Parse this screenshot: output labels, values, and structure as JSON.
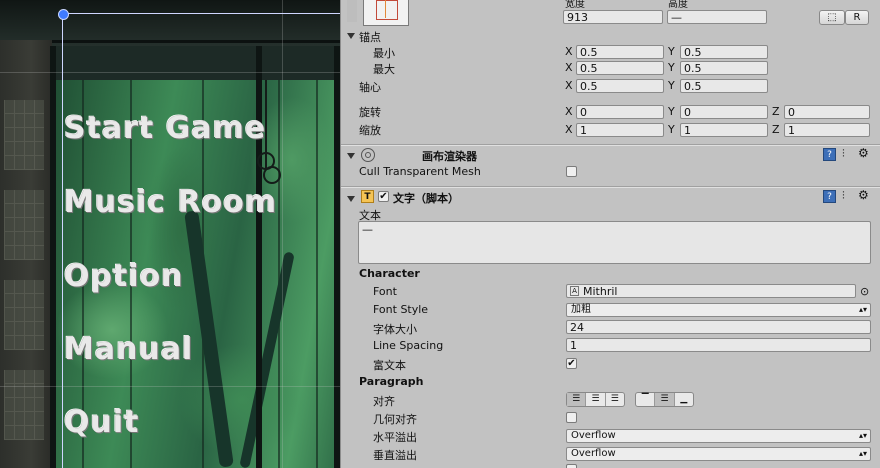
{
  "scene": {
    "menu_items": [
      "Start Game",
      "Music Room",
      "Option",
      "Manual",
      "Quit"
    ]
  },
  "rect_transform": {
    "width_label": "宽度",
    "height_label": "高度",
    "width_value": "913",
    "height_value": "—",
    "r_button": "R",
    "anchors_label": "锚点",
    "min_label": "最小",
    "max_label": "最大",
    "pivot_label": "轴心",
    "rotation_label": "旋转",
    "scale_label": "缩放",
    "anchor_min": {
      "x": "0.5",
      "y": "0.5"
    },
    "anchor_max": {
      "x": "0.5",
      "y": "0.5"
    },
    "pivot": {
      "x": "0.5",
      "y": "0.5"
    },
    "rotation": {
      "x": "0",
      "y": "0",
      "z": "0"
    },
    "scale": {
      "x": "1",
      "y": "1",
      "z": "1"
    },
    "axis_x": "X",
    "axis_y": "Y",
    "axis_z": "Z"
  },
  "canvas_renderer": {
    "title": "画布渲染器",
    "cull_label": "Cull Transparent Mesh",
    "cull_checked": false
  },
  "text_component": {
    "title": "文字（脚本）",
    "enabled": true,
    "text_label": "文本",
    "text_value": "—",
    "character_header": "Character",
    "font_label": "Font",
    "font_value": "Mithril",
    "font_style_label": "Font Style",
    "font_style_value": "加粗",
    "font_size_label": "字体大小",
    "font_size_value": "24",
    "line_spacing_label": "Line Spacing",
    "line_spacing_value": "1",
    "rich_text_label": "富文本",
    "rich_text_checked": true,
    "paragraph_header": "Paragraph",
    "alignment_label": "对齐",
    "geometry_align_label": "几何对齐",
    "geometry_align_checked": false,
    "horizontal_overflow_label": "水平溢出",
    "horizontal_overflow_value": "Overflow",
    "vertical_overflow_label": "垂直溢出",
    "vertical_overflow_value": "Overflow"
  },
  "colors": {
    "inspector_bg": "#c2c2c2",
    "field_bg": "#e8e8e8",
    "handle_blue": "#3f7bff",
    "help_icon_blue": "#3d6fb8"
  }
}
